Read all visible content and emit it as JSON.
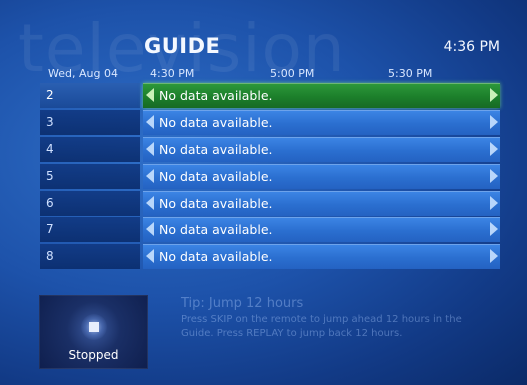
{
  "header": {
    "watermark": "television",
    "title": "GUIDE",
    "clock": "4:36 PM"
  },
  "timeline": {
    "date": "Wed, Aug 04",
    "times": [
      "4:30 PM",
      "5:00 PM",
      "5:30 PM"
    ]
  },
  "rows": [
    {
      "channel": "2",
      "program": "No data available."
    },
    {
      "channel": "3",
      "program": "No data available."
    },
    {
      "channel": "4",
      "program": "No data available."
    },
    {
      "channel": "5",
      "program": "No data available."
    },
    {
      "channel": "6",
      "program": "No data available."
    },
    {
      "channel": "7",
      "program": "No data available."
    },
    {
      "channel": "8",
      "program": "No data available."
    }
  ],
  "preview": {
    "status": "Stopped",
    "icon": "stop-icon"
  },
  "tip": {
    "title": "Tip: Jump 12 hours",
    "body": "Press SKIP on the remote to jump ahead 12 hours in the Guide. Press REPLAY to jump back 12 hours."
  },
  "colors": {
    "background": "#1d52aa",
    "program_cell": "#2b6fd0",
    "selected_cell": "#1c7f2b"
  }
}
